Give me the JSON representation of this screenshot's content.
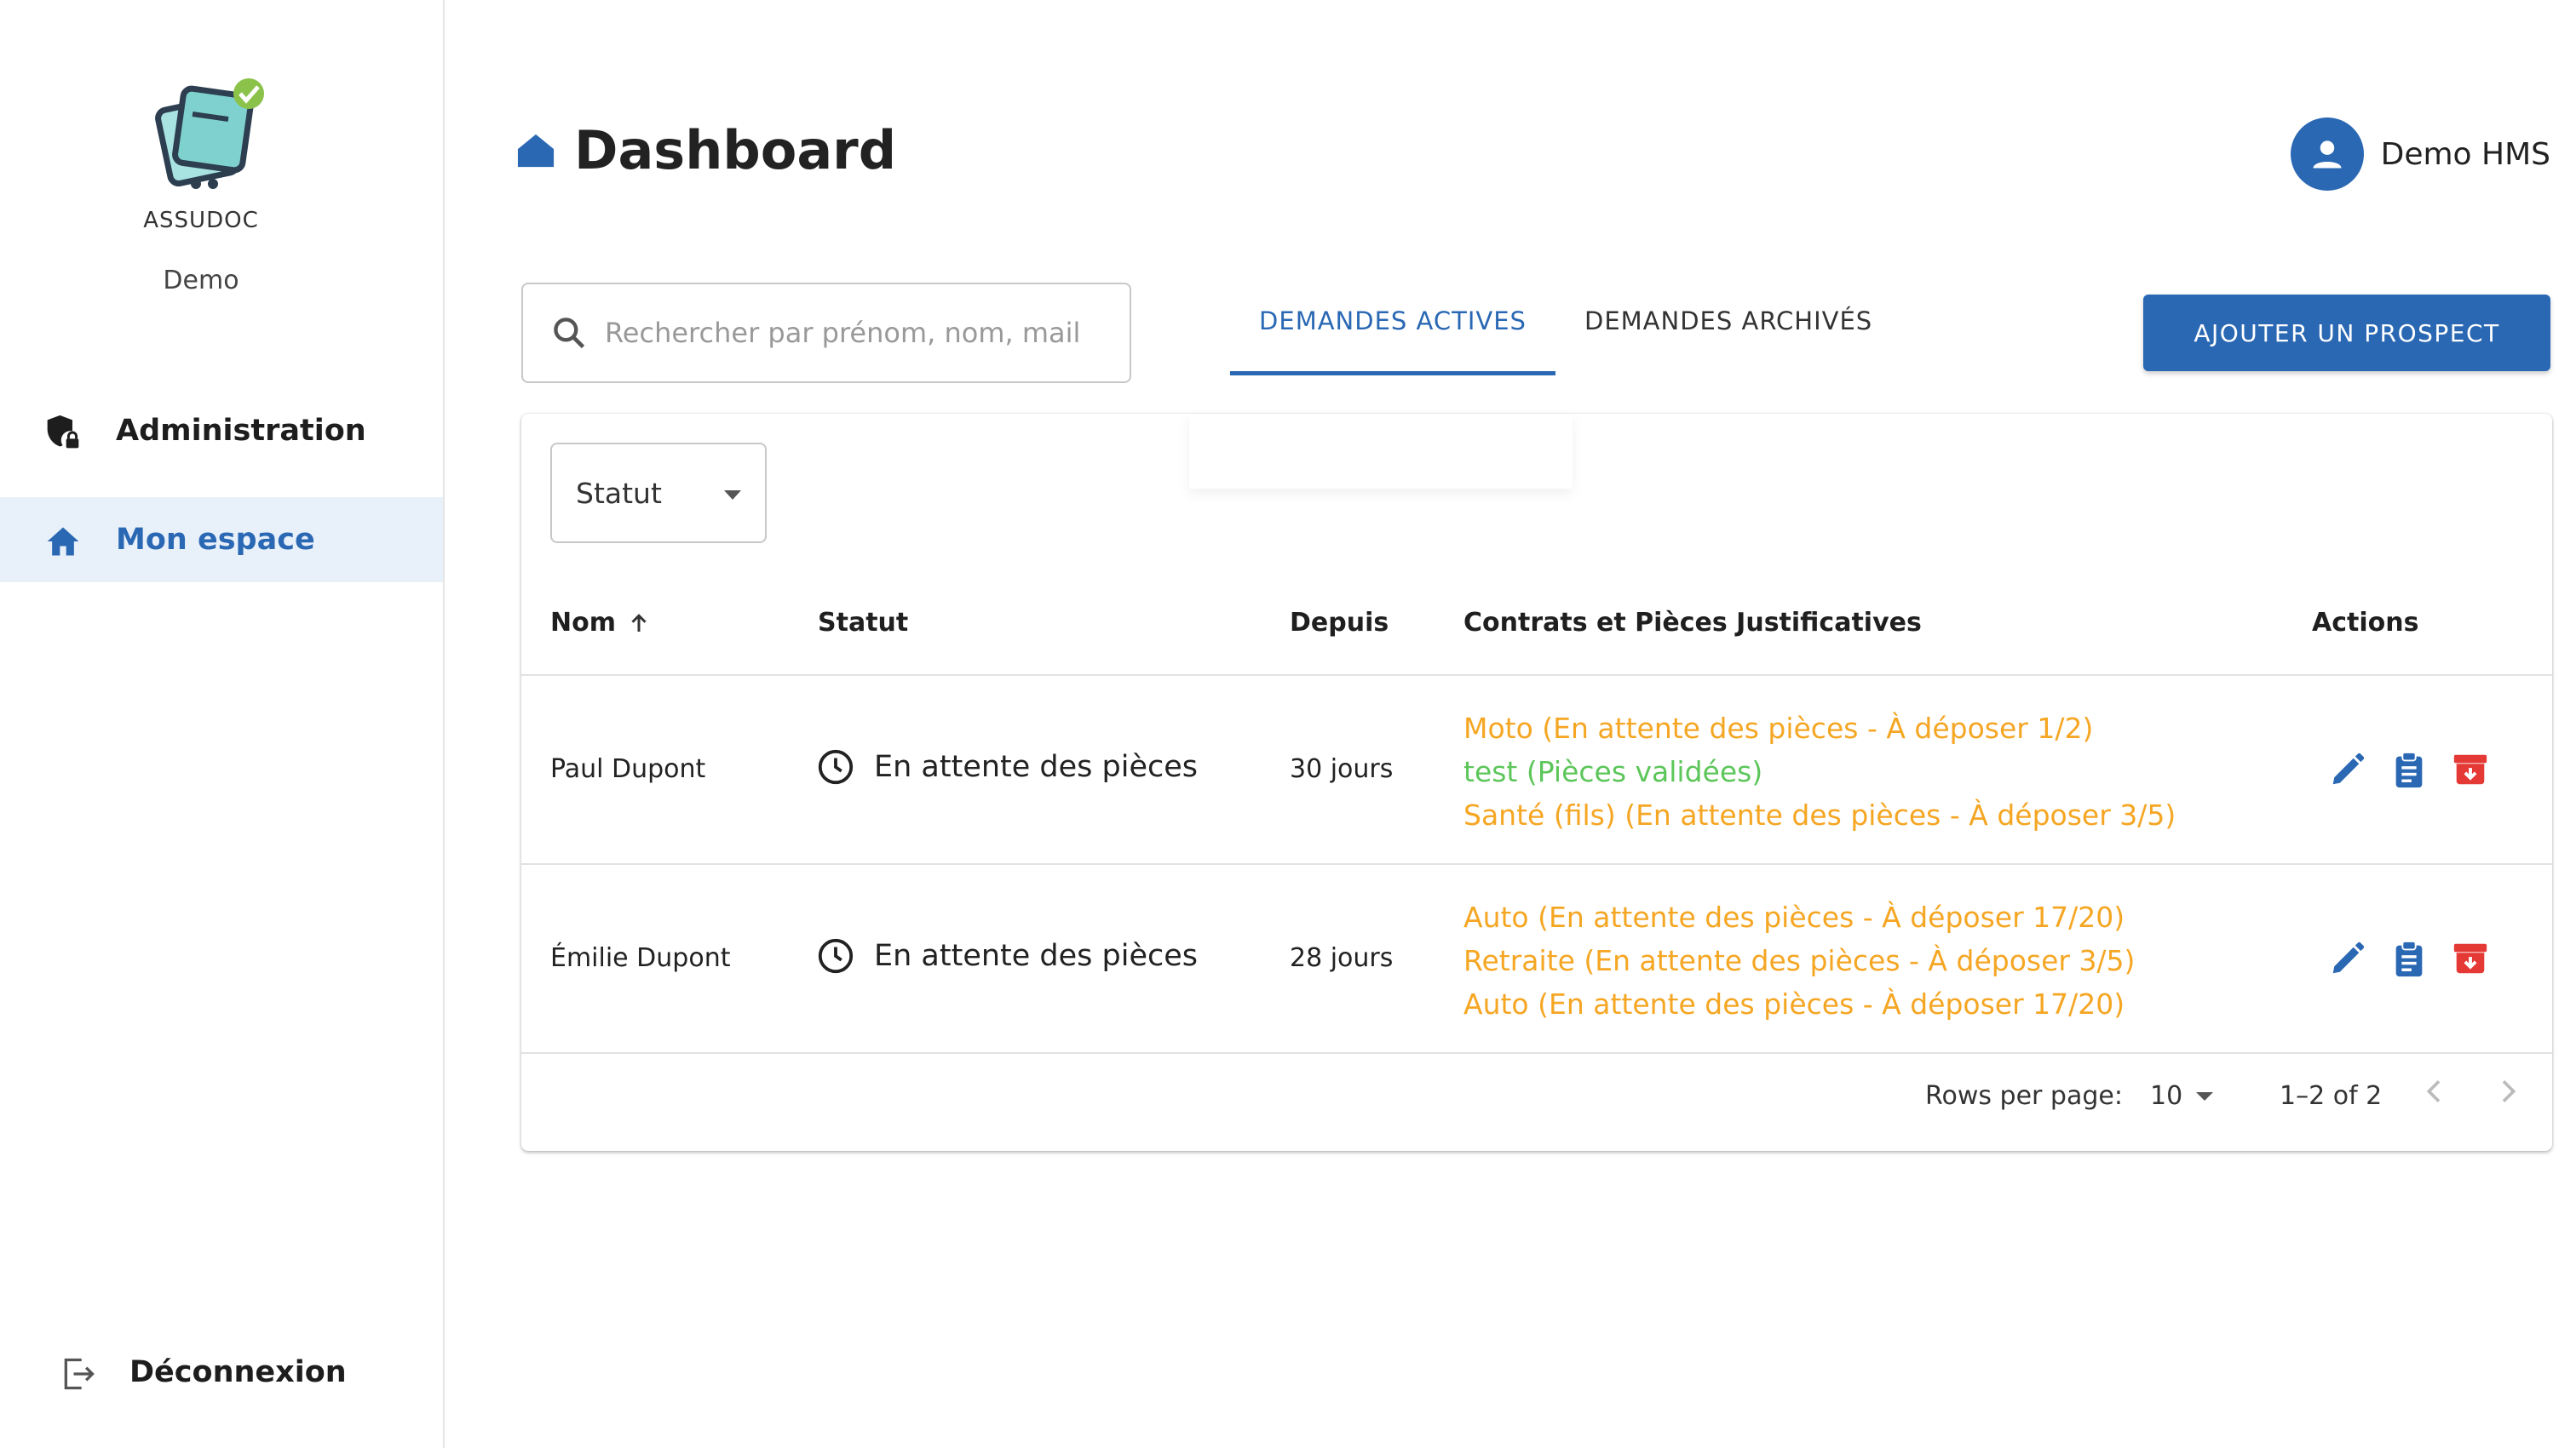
{
  "app": {
    "brand": "ASSUDOC",
    "org": "Demo"
  },
  "sidebar": {
    "items": [
      {
        "label": "Administration",
        "icon": "shield-lock-icon"
      },
      {
        "label": "Mon espace",
        "icon": "home-icon",
        "active": true
      }
    ],
    "logout_label": "Déconnexion"
  },
  "header": {
    "title": "Dashboard",
    "user_name": "Demo HMS"
  },
  "search": {
    "placeholder": "Rechercher par prénom, nom, mail"
  },
  "tabs": [
    {
      "label": "DEMANDES ACTIVES",
      "active": true
    },
    {
      "label": "DEMANDES ARCHIVÉS",
      "active": false
    }
  ],
  "add_button_label": "AJOUTER UN PROSPECT",
  "filter": {
    "status_label": "Statut"
  },
  "table": {
    "columns": [
      "Nom",
      "Statut",
      "Depuis",
      "Contrats et Pièces Justificatives",
      "Actions"
    ],
    "rows": [
      {
        "name": "Paul Dupont",
        "status": "En attente des pièces",
        "since": "30 jours",
        "contracts": [
          {
            "text": "Moto (En attente des pièces - À déposer 1/2)",
            "state": "pending"
          },
          {
            "text": "test (Pièces validées)",
            "state": "valid"
          },
          {
            "text": "Santé (fils) (En attente des pièces - À déposer 3/5)",
            "state": "pending"
          }
        ]
      },
      {
        "name": "Émilie Dupont",
        "status": "En attente des pièces",
        "since": "28 jours",
        "contracts": [
          {
            "text": "Auto (En attente des pièces - À déposer 17/20)",
            "state": "pending"
          },
          {
            "text": "Retraite (En attente des pièces - À déposer 3/5)",
            "state": "pending"
          },
          {
            "text": "Auto (En attente des pièces - À déposer 17/20)",
            "state": "pending"
          }
        ]
      }
    ]
  },
  "pagination": {
    "rows_per_page_label": "Rows per page:",
    "rows_per_page": "10",
    "range": "1–2 of 2"
  },
  "colors": {
    "primary": "#2a68b4",
    "pending": "#f5a623",
    "valid": "#5cc65a",
    "danger": "#e53935",
    "nav_active_bg": "#e8f0fa"
  }
}
